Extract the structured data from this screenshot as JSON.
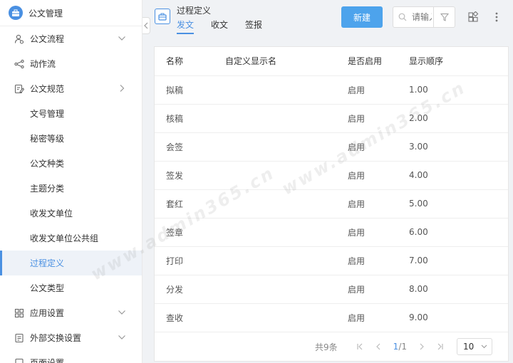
{
  "app": {
    "title": "公文管理"
  },
  "sidebar": {
    "items": [
      {
        "label": "公文流程",
        "level": "top",
        "icon": "user-flow-icon",
        "chevron": "down"
      },
      {
        "label": "动作流",
        "level": "top",
        "icon": "branch-icon",
        "chevron": ""
      },
      {
        "label": "公文规范",
        "level": "top",
        "icon": "doc-edit-icon",
        "chevron": "right"
      },
      {
        "label": "文号管理",
        "level": "sub"
      },
      {
        "label": "秘密等级",
        "level": "sub"
      },
      {
        "label": "公文种类",
        "level": "sub"
      },
      {
        "label": "主题分类",
        "level": "sub"
      },
      {
        "label": "收发文单位",
        "level": "sub"
      },
      {
        "label": "收发文单位公共组",
        "level": "sub"
      },
      {
        "label": "过程定义",
        "level": "sub",
        "active": true
      },
      {
        "label": "公文类型",
        "level": "sub"
      },
      {
        "label": "应用设置",
        "level": "top",
        "icon": "grid-icon",
        "chevron": "down"
      },
      {
        "label": "外部交换设置",
        "level": "top",
        "icon": "exchange-doc-icon",
        "chevron": "down"
      },
      {
        "label": "页面设置",
        "level": "top",
        "icon": "page-icon",
        "chevron": ""
      }
    ]
  },
  "header": {
    "title": "过程定义",
    "tabs": [
      {
        "label": "发文",
        "active": true
      },
      {
        "label": "收文"
      },
      {
        "label": "签报"
      }
    ],
    "new_button": "新建",
    "search_placeholder": "请输入"
  },
  "table": {
    "columns": [
      "名称",
      "自定义显示名",
      "是否启用",
      "显示顺序"
    ],
    "rows": [
      [
        "拟稿",
        "",
        "启用",
        "1.00"
      ],
      [
        "核稿",
        "",
        "启用",
        "2.00"
      ],
      [
        "会签",
        "",
        "启用",
        "3.00"
      ],
      [
        "签发",
        "",
        "启用",
        "4.00"
      ],
      [
        "套红",
        "",
        "启用",
        "5.00"
      ],
      [
        "签章",
        "",
        "启用",
        "6.00"
      ],
      [
        "打印",
        "",
        "启用",
        "7.00"
      ],
      [
        "分发",
        "",
        "启用",
        "8.00"
      ],
      [
        "查收",
        "",
        "启用",
        "9.00"
      ]
    ]
  },
  "pagination": {
    "total_text": "共9条",
    "current": "1",
    "total_pages": "/1",
    "page_size": "10"
  },
  "watermark": "www.admin365.cn",
  "colors": {
    "accent": "#4a90e2",
    "primary_button": "#4da3ec"
  }
}
